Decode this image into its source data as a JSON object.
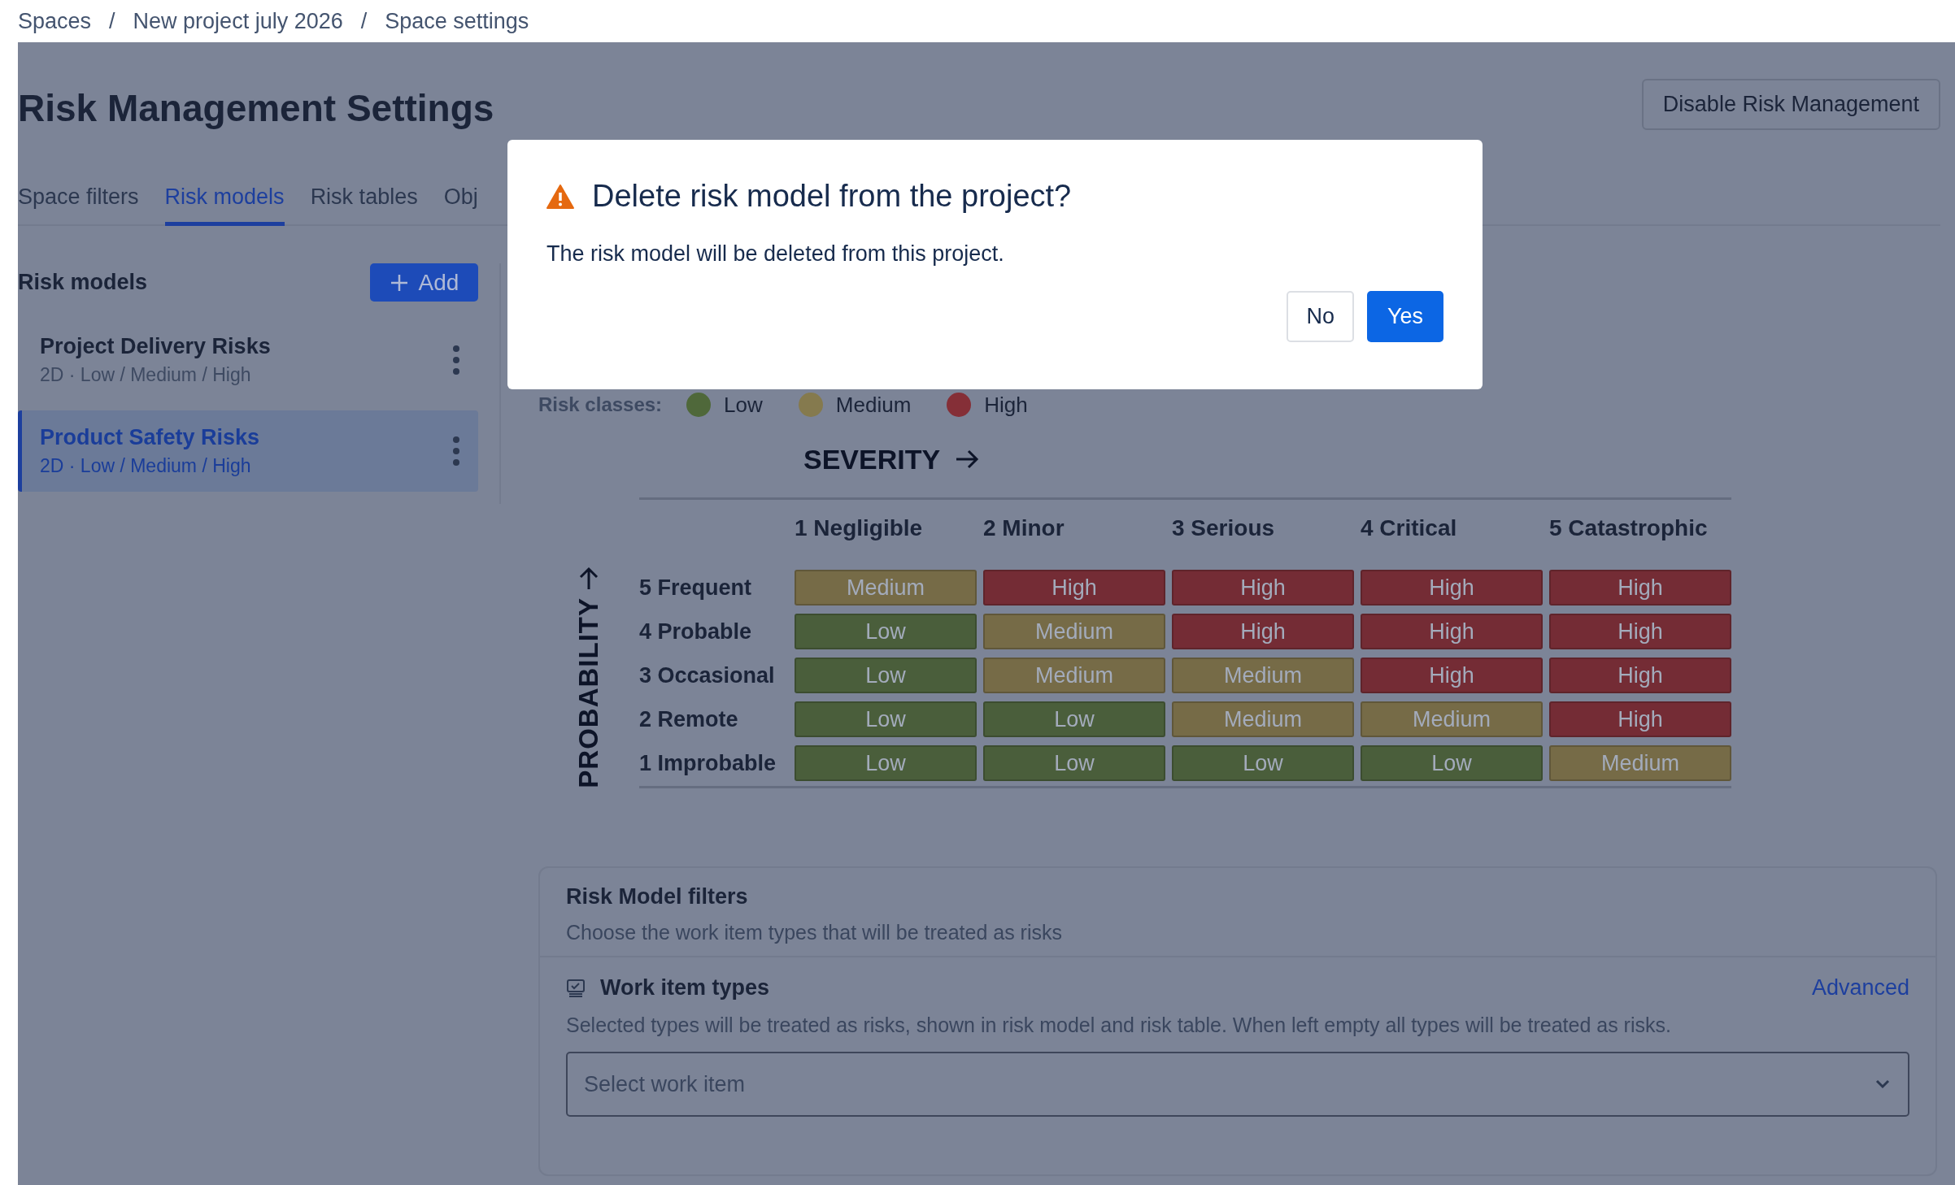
{
  "breadcrumb": {
    "items": [
      "Spaces",
      "New project july 2026",
      "Space settings"
    ],
    "separators": [
      "/",
      "/"
    ]
  },
  "title": "Risk Management Settings",
  "disable_button": "Disable Risk Management",
  "tabs": [
    {
      "label": "Space filters",
      "selected": false
    },
    {
      "label": "Risk models",
      "selected": true
    },
    {
      "label": "Risk tables",
      "selected": false
    },
    {
      "label": "Obj",
      "selected": false
    }
  ],
  "sidebar": {
    "heading": "Risk models",
    "add_button": "Add",
    "models": [
      {
        "name": "Project Delivery Risks",
        "summary": "2D · Low / Medium / High",
        "selected": false
      },
      {
        "name": "Product Safety Risks",
        "summary": "2D · Low / Medium / High",
        "selected": true
      }
    ]
  },
  "risk_classes": {
    "label": "Risk classes:",
    "classes": [
      {
        "name": "Low",
        "color": "#4f683a"
      },
      {
        "name": "Medium",
        "color": "#857a4e"
      },
      {
        "name": "High",
        "color": "#852f37"
      }
    ]
  },
  "matrix": {
    "severity_label": "SEVERITY",
    "probability_label": "PROBABILITY",
    "columns": [
      "1 Negligible",
      "2 Minor",
      "3 Serious",
      "4 Critical",
      "5 Catastrophic"
    ],
    "rows": [
      {
        "label": "5 Frequent",
        "cells": [
          {
            "label": "Medium",
            "color": "#766b47"
          },
          {
            "label": "High",
            "color": "#742c35"
          },
          {
            "label": "High",
            "color": "#742c35"
          },
          {
            "label": "High",
            "color": "#742c35"
          },
          {
            "label": "High",
            "color": "#742c35"
          }
        ]
      },
      {
        "label": "4 Probable",
        "cells": [
          {
            "label": "Low",
            "color": "#4a5e3b"
          },
          {
            "label": "Medium",
            "color": "#766b47"
          },
          {
            "label": "High",
            "color": "#742c35"
          },
          {
            "label": "High",
            "color": "#742c35"
          },
          {
            "label": "High",
            "color": "#742c35"
          }
        ]
      },
      {
        "label": "3 Occasional",
        "cells": [
          {
            "label": "Low",
            "color": "#4a5e3b"
          },
          {
            "label": "Medium",
            "color": "#766b47"
          },
          {
            "label": "Medium",
            "color": "#766b47"
          },
          {
            "label": "High",
            "color": "#742c35"
          },
          {
            "label": "High",
            "color": "#742c35"
          }
        ]
      },
      {
        "label": "2 Remote",
        "cells": [
          {
            "label": "Low",
            "color": "#4a5e3b"
          },
          {
            "label": "Low",
            "color": "#4a5e3b"
          },
          {
            "label": "Medium",
            "color": "#766b47"
          },
          {
            "label": "Medium",
            "color": "#766b47"
          },
          {
            "label": "High",
            "color": "#742c35"
          }
        ]
      },
      {
        "label": "1 Improbable",
        "cells": [
          {
            "label": "Low",
            "color": "#4a5e3b"
          },
          {
            "label": "Low",
            "color": "#4a5e3b"
          },
          {
            "label": "Low",
            "color": "#4a5e3b"
          },
          {
            "label": "Low",
            "color": "#4a5e3b"
          },
          {
            "label": "Medium",
            "color": "#766b47"
          }
        ]
      }
    ]
  },
  "filters": {
    "title": "Risk Model filters",
    "subtitle": "Choose the work item types that will be treated as risks",
    "section": {
      "title": "Work item types",
      "link": "Advanced",
      "description": "Selected types will be treated as risks, shown in risk model and risk table. When left empty all types will be treated as risks.",
      "placeholder": "Select work item"
    }
  },
  "modal": {
    "title": "Delete risk model from the project?",
    "body": "The risk model will be deleted from this project.",
    "buttons": [
      {
        "label": "No",
        "kind": "secondary"
      },
      {
        "label": "Yes",
        "kind": "primary"
      }
    ]
  }
}
